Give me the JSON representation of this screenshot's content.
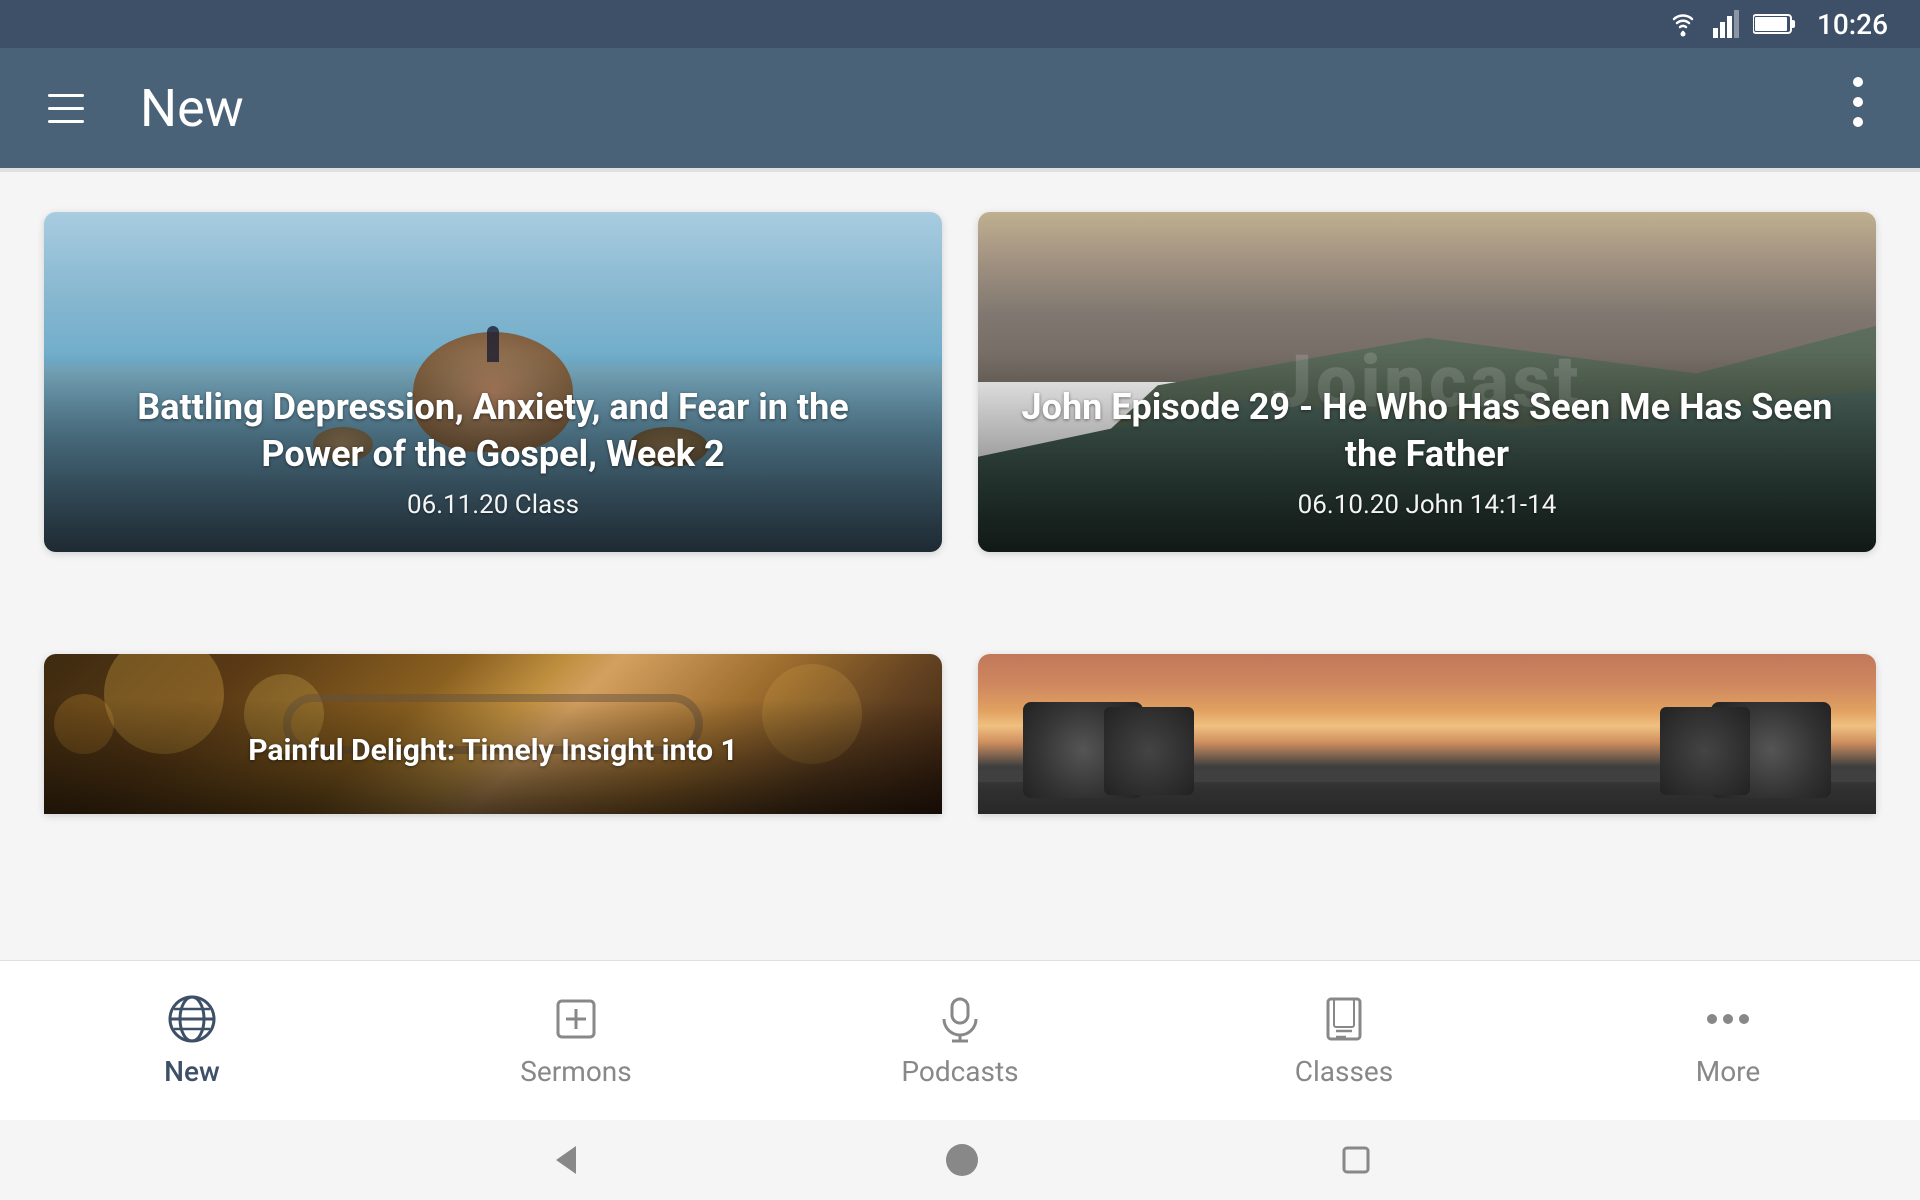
{
  "statusBar": {
    "time": "10:26",
    "wifiIcon": "wifi",
    "signalIcon": "signal",
    "batteryIcon": "battery"
  },
  "toolbar": {
    "menuIcon": "hamburger-menu",
    "title": "New",
    "moreIcon": "vertical-dots"
  },
  "cards": [
    {
      "id": "card-1",
      "title": "Battling Depression, Anxiety, and Fear in the Power of the Gospel, Week 2",
      "meta": "06.11.20  Class",
      "bgType": "lake"
    },
    {
      "id": "card-2",
      "title": "John Episode 29 - He Who Has Seen Me Has Seen the Father",
      "meta": "06.10.20  John 14:1-14",
      "bgType": "mountain",
      "watermark": "Joincast"
    },
    {
      "id": "card-3",
      "title": "Painful Delight: Timely Insight into 1",
      "meta": "",
      "bgType": "glasses"
    },
    {
      "id": "card-4",
      "title": "",
      "meta": "",
      "bgType": "gym"
    }
  ],
  "bottomNav": {
    "items": [
      {
        "id": "new",
        "label": "New",
        "icon": "globe",
        "active": true
      },
      {
        "id": "sermons",
        "label": "Sermons",
        "icon": "plus-square",
        "active": false
      },
      {
        "id": "podcasts",
        "label": "Podcasts",
        "icon": "microphone",
        "active": false
      },
      {
        "id": "classes",
        "label": "Classes",
        "icon": "journal",
        "active": false
      },
      {
        "id": "more",
        "label": "More",
        "icon": "dots-horizontal",
        "active": false
      }
    ]
  },
  "systemNav": {
    "backIcon": "triangle-back",
    "homeIcon": "circle-home",
    "recentsIcon": "square-recents"
  }
}
